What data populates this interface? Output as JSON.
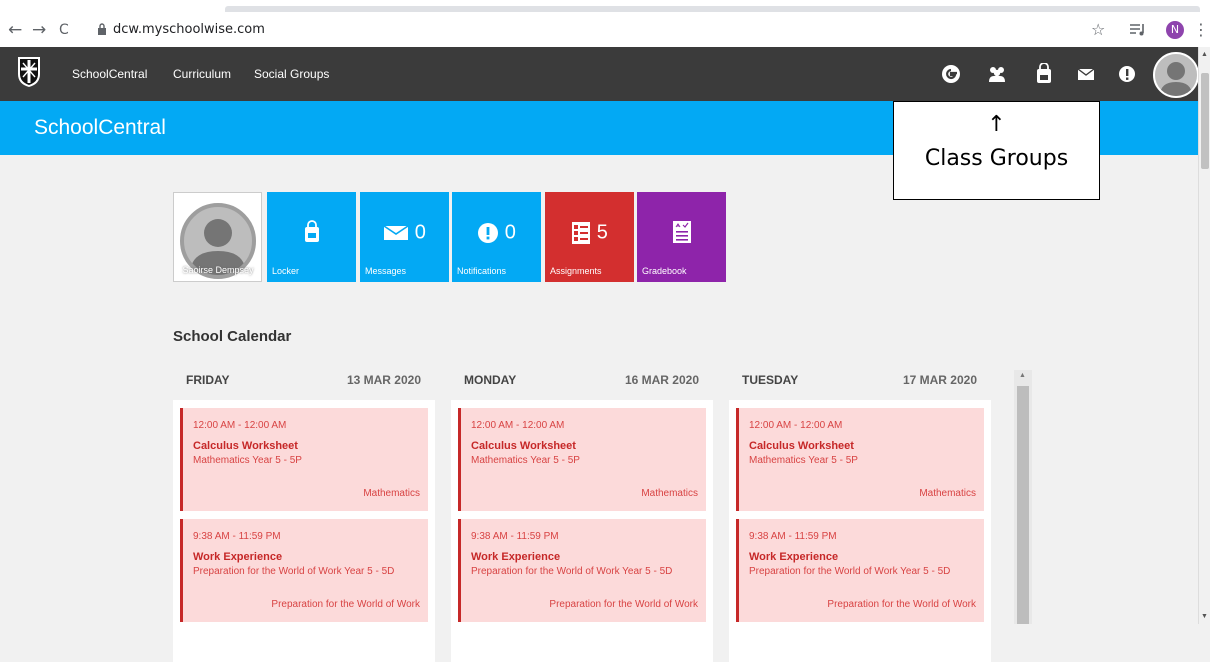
{
  "browser": {
    "back": "←",
    "forward": "→",
    "reload": "C",
    "url": "dcw.myschoolwise.com",
    "star": "☆",
    "menu": "⋮",
    "profile_initial": "N"
  },
  "nav": {
    "links": [
      "SchoolCentral",
      "Curriculum",
      "Social Groups"
    ],
    "icons": [
      "google-icon",
      "class-groups-icon",
      "locker-icon",
      "messages-icon",
      "notifications-icon"
    ]
  },
  "header": {
    "title": "SchoolCentral"
  },
  "annotation": {
    "arrow": "↑",
    "label": "Class Groups"
  },
  "tiles": {
    "profile_name": "Saoirse Dempsey",
    "locker": {
      "label": "Locker"
    },
    "messages": {
      "label": "Messages",
      "count": "0"
    },
    "notifications": {
      "label": "Notifications",
      "count": "0"
    },
    "assignments": {
      "label": "Assignments",
      "count": "5"
    },
    "gradebook": {
      "label": "Gradebook"
    }
  },
  "colors": {
    "tile_blue": "#03a9f4",
    "tile_red": "#d32f2f",
    "tile_purple": "#8e24aa",
    "nav_dark": "#3b3b3b",
    "event_pink": "#fcdada"
  },
  "calendar": {
    "heading": "School Calendar",
    "days": [
      {
        "name": "FRIDAY",
        "date": "13 MAR 2020",
        "events": [
          {
            "time": "12:00 AM - 12:00 AM",
            "title": "Calculus Worksheet",
            "class": "Mathematics Year 5 - 5P",
            "subject": "Mathematics"
          },
          {
            "time": "9:38 AM - 11:59 PM",
            "title": "Work Experience",
            "class": "Preparation for the World of Work Year 5 - 5D",
            "subject": "Preparation for the World of Work"
          }
        ]
      },
      {
        "name": "MONDAY",
        "date": "16 MAR 2020",
        "events": [
          {
            "time": "12:00 AM - 12:00 AM",
            "title": "Calculus Worksheet",
            "class": "Mathematics Year 5 - 5P",
            "subject": "Mathematics"
          },
          {
            "time": "9:38 AM - 11:59 PM",
            "title": "Work Experience",
            "class": "Preparation for the World of Work Year 5 - 5D",
            "subject": "Preparation for the World of Work"
          }
        ]
      },
      {
        "name": "TUESDAY",
        "date": "17 MAR 2020",
        "events": [
          {
            "time": "12:00 AM - 12:00 AM",
            "title": "Calculus Worksheet",
            "class": "Mathematics Year 5 - 5P",
            "subject": "Mathematics"
          },
          {
            "time": "9:38 AM - 11:59 PM",
            "title": "Work Experience",
            "class": "Preparation for the World of Work Year 5 - 5D",
            "subject": "Preparation for the World of Work"
          }
        ]
      }
    ]
  }
}
